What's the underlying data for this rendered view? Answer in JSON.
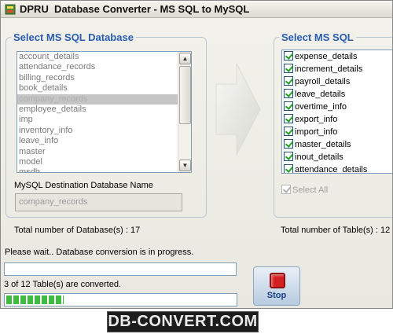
{
  "window": {
    "title": "DPRU  Database Converter - MS SQL to MySQL"
  },
  "left_panel": {
    "title": "Select MS SQL Database",
    "databases": [
      "account_details",
      "attendance_records",
      "billing_records",
      "book_details",
      "company_records",
      "employee_details",
      "imp",
      "inventory_info",
      "leave_info",
      "master",
      "model",
      "msdb"
    ],
    "selected": "company_records",
    "dest_label": "MySQL Destination Database Name",
    "dest_value": "company_records",
    "total_label": "Total number of Database(s) :  17"
  },
  "right_panel": {
    "title": "Select MS SQL",
    "tables": [
      "expense_details",
      "increment_details",
      "payroll_details",
      "leave_details",
      "overtime_info",
      "export_info",
      "import_info",
      "master_details",
      "inout_details",
      "attendance_details"
    ],
    "select_all_label": "Select All",
    "total_label": "Total number of Table(s) :  12"
  },
  "status": {
    "message": "Please wait.. Database conversion is in progress.",
    "progress_text": "3 of 12 Table(s) are converted.",
    "progress_fraction": 0.25
  },
  "stop_button": {
    "label": "Stop"
  },
  "brand": "DB-CONVERT.COM",
  "colors": {
    "group_title": "#2a5db0",
    "progress": "#3fbb3f",
    "stop": "#d42020"
  },
  "icons": [
    "app-icon",
    "arrow-right-icon",
    "stop-icon",
    "scroll-up-icon",
    "scroll-down-icon"
  ]
}
